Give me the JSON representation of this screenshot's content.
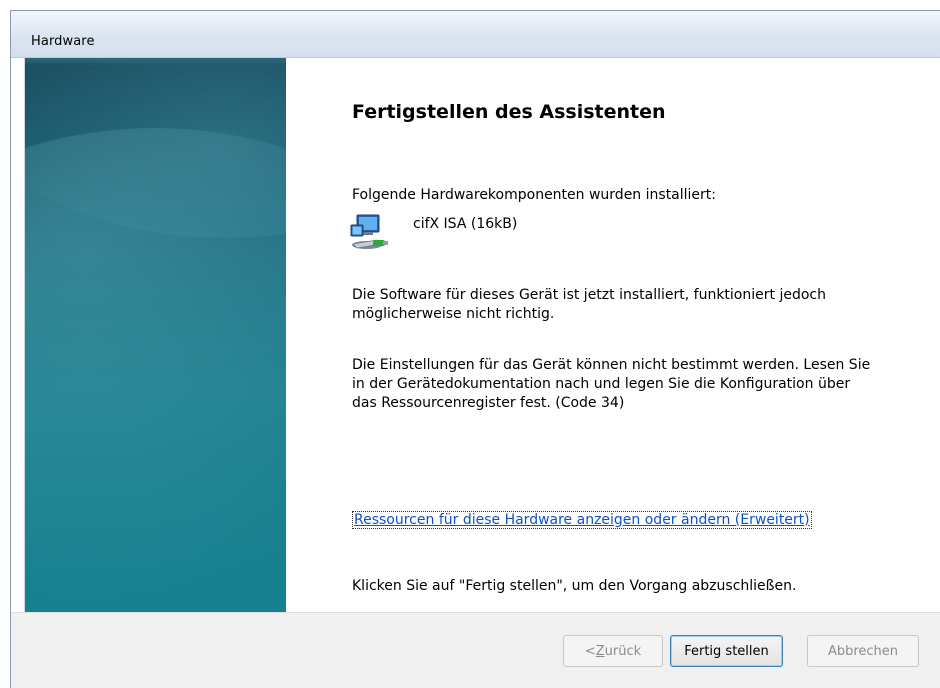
{
  "window": {
    "title": "Hardware"
  },
  "main": {
    "heading": "Fertigstellen des Assistenten",
    "intro": "Folgende Hardwarekomponenten wurden installiert:",
    "device": {
      "icon": "network-computer-icon",
      "name": "cifX ISA (16kB)"
    },
    "para1": "Die Software für dieses Gerät ist jetzt installiert, funktioniert jedoch möglicherweise nicht richtig.",
    "para2": "Die Einstellungen für das Gerät können nicht bestimmt werden. Lesen Sie in der Gerätedokumentation nach und legen Sie die Konfiguration über das Ressourcenregister fest. (Code 34)",
    "link": "Ressourcen für diese Hardware anzeigen oder ändern (Erweitert)",
    "finish_text": "Klicken Sie auf \"Fertig stellen\", um den Vorgang abzuschließen."
  },
  "buttons": {
    "back_prefix": "< ",
    "back_mnemonic": "Z",
    "back_rest": "urück",
    "finish": "Fertig stellen",
    "cancel": "Abbrechen"
  }
}
